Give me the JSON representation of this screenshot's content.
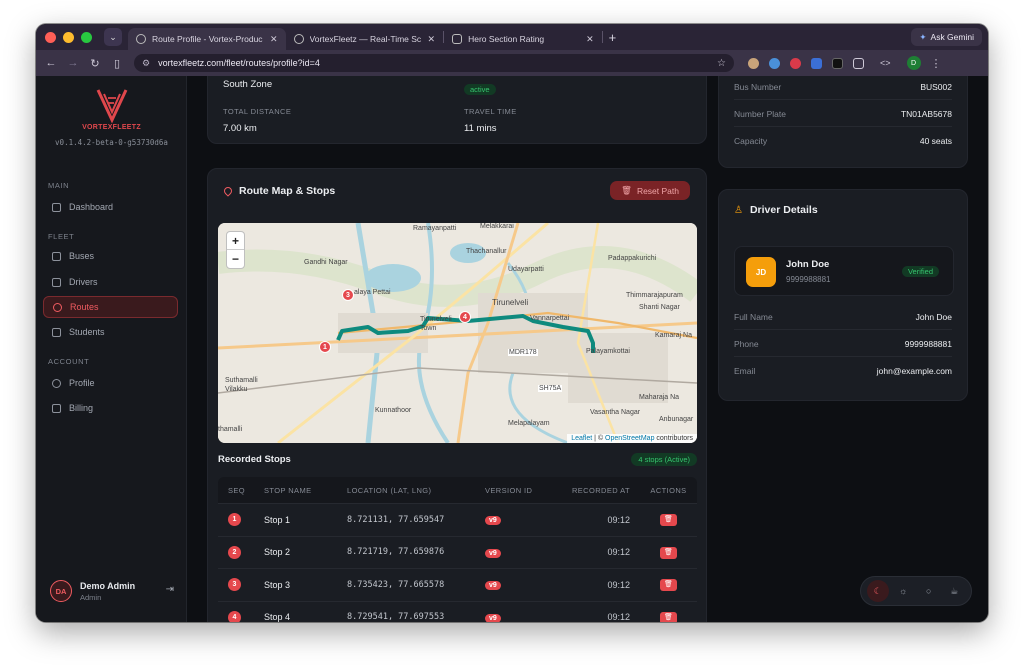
{
  "browser": {
    "tabs": [
      {
        "title": "Route Profile - Vortex-Produc",
        "active": true
      },
      {
        "title": "VortexFleetz — Real-Time Sc",
        "active": false
      },
      {
        "title": "Hero Section Rating",
        "active": false
      }
    ],
    "ask_gemini": "Ask Gemini",
    "url": "vortexfleetz.com/fleet/routes/profile?id=4",
    "profile_initial": "D"
  },
  "sidebar": {
    "brand": "VORTEXFLEETZ",
    "version": "v0.1.4.2-beta-0-g53730d6a",
    "sections": {
      "main": "MAIN",
      "fleet": "FLEET",
      "account": "ACCOUNT"
    },
    "items": [
      {
        "label": "Dashboard",
        "icon": "grid-icon"
      },
      {
        "label": "Buses",
        "icon": "bus-icon"
      },
      {
        "label": "Drivers",
        "icon": "users-icon"
      },
      {
        "label": "Routes",
        "icon": "pin-icon",
        "active": true
      },
      {
        "label": "Students",
        "icon": "book-icon"
      },
      {
        "label": "Profile",
        "icon": "user-icon"
      },
      {
        "label": "Billing",
        "icon": "card-icon"
      }
    ],
    "user": {
      "initials": "DA",
      "name": "Demo Admin",
      "role": "Admin"
    }
  },
  "route_summary": {
    "zone": "South Zone",
    "status": "active",
    "total_distance_label": "TOTAL DISTANCE",
    "total_distance": "7.00 km",
    "travel_time_label": "TRAVEL TIME",
    "travel_time": "11 mins"
  },
  "map_card": {
    "title": "Route Map & Stops",
    "reset_button": "Reset Path",
    "zoom_in": "+",
    "zoom_out": "−",
    "attribution": {
      "leaflet": "Leaflet",
      "sep": " | © ",
      "osm": "OpenStreetMap",
      "tail": " contributors"
    },
    "places": [
      "Ramayanpatti",
      "Melakkarai",
      "Gandhi Nagar",
      "Thachanallur",
      "Udayarpatti",
      "Padappakurichi",
      "alaya Pettai",
      "Thimmarajapuram",
      "Shanti Nagar",
      "Tirunelveli",
      "Tirunelveli Town",
      "Vannarpettai",
      "Kamaraj Na",
      "MDR178",
      "Palayamkottai",
      "Suthamalli Vilakku",
      "SH75A",
      "Maharaja Na",
      "Kunnathoor",
      "Vasantha Nagar",
      "Anbunagar",
      "thamalli",
      "Melapalayam"
    ],
    "markers": [
      "1",
      "3",
      "4"
    ]
  },
  "stops": {
    "heading": "Recorded Stops",
    "badge": "4 stops (Active)",
    "columns": [
      "SEQ",
      "STOP NAME",
      "LOCATION (LAT, LNG)",
      "VERSION ID",
      "RECORDED AT",
      "ACTIONS"
    ],
    "rows": [
      {
        "seq": "1",
        "name": "Stop 1",
        "location": "8.721131, 77.659547",
        "version": "v9",
        "recorded": "09:12"
      },
      {
        "seq": "2",
        "name": "Stop 2",
        "location": "8.721719, 77.659876",
        "version": "v9",
        "recorded": "09:12"
      },
      {
        "seq": "3",
        "name": "Stop 3",
        "location": "8.735423, 77.665578",
        "version": "v9",
        "recorded": "09:12"
      },
      {
        "seq": "4",
        "name": "Stop 4",
        "location": "8.729541, 77.697553",
        "version": "v9",
        "recorded": "09:12"
      }
    ]
  },
  "bus_card": {
    "bus_number_label": "Bus Number",
    "bus_number": "BUS002",
    "plate_label": "Number Plate",
    "plate": "TN01AB5678",
    "capacity_label": "Capacity",
    "capacity": "40 seats"
  },
  "driver_card": {
    "title": "Driver Details",
    "initials": "JD",
    "name": "John Doe",
    "phone_short": "9999988881",
    "status": "Verified",
    "full_name_label": "Full Name",
    "full_name": "John Doe",
    "phone_label": "Phone",
    "phone": "9999988881",
    "email_label": "Email",
    "email": "john@example.com"
  },
  "theme_options": [
    "moon-icon",
    "sun-icon",
    "circle-icon",
    "cup-icon"
  ],
  "colors": {
    "accent": "#e5484d",
    "success": "#36c46e",
    "route_line": "#0e8a7e",
    "avatar": "#f59e0b"
  }
}
